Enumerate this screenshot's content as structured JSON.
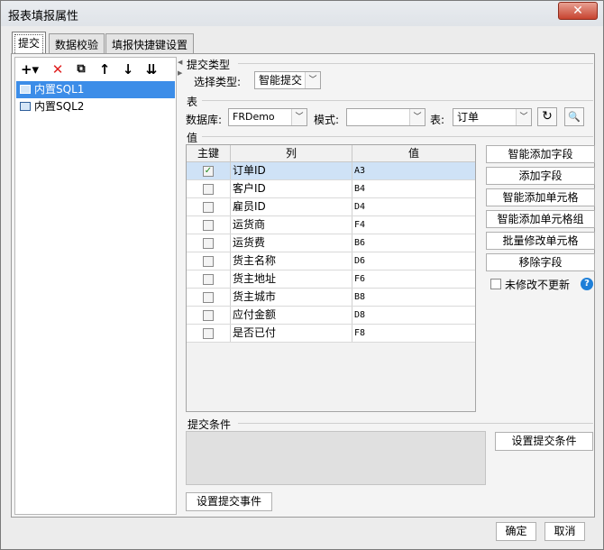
{
  "window": {
    "title": "报表填报属性",
    "close_glyph": "✕"
  },
  "tabs": [
    {
      "label": "提交",
      "active": true
    },
    {
      "label": "数据校验",
      "active": false
    },
    {
      "label": "填报快捷键设置",
      "active": false
    }
  ],
  "left_toolbar": {
    "icons": [
      "add-icon",
      "delete-icon",
      "copy-icon",
      "move-up-icon",
      "move-down-icon",
      "move-bottom-icon"
    ],
    "glyphs": [
      "+▾",
      "✕",
      "⧉",
      "↑",
      "↓",
      "⇊"
    ]
  },
  "left_list": [
    {
      "label": "内置SQL1",
      "selected": true
    },
    {
      "label": "内置SQL2",
      "selected": false
    }
  ],
  "submit_type": {
    "section": "提交类型",
    "label": "选择类型:",
    "value": "智能提交"
  },
  "table_section": {
    "section": "表",
    "db_label": "数据库:",
    "db_value": "FRDemo",
    "mode_label": "模式:",
    "mode_value": "",
    "table_label": "表:",
    "table_value": "订单",
    "refresh_glyph": "↻",
    "preview_glyph": "🔍"
  },
  "value_section": {
    "section": "值",
    "headers": [
      "主键",
      "列",
      "值"
    ],
    "rows": [
      {
        "key": true,
        "column": "订单ID",
        "value": "A3"
      },
      {
        "key": false,
        "column": "客户ID",
        "value": "B4"
      },
      {
        "key": false,
        "column": "雇员ID",
        "value": "D4"
      },
      {
        "key": false,
        "column": "运货商",
        "value": "F4"
      },
      {
        "key": false,
        "column": "运货费",
        "value": "B6"
      },
      {
        "key": false,
        "column": "货主名称",
        "value": "D6"
      },
      {
        "key": false,
        "column": "货主地址",
        "value": "F6"
      },
      {
        "key": false,
        "column": "货主城市",
        "value": "B8"
      },
      {
        "key": false,
        "column": "应付金额",
        "value": "D8"
      },
      {
        "key": false,
        "column": "是否已付",
        "value": "F8"
      }
    ],
    "check_glyph": "✓"
  },
  "side_buttons": [
    "智能添加字段",
    "添加字段",
    "智能添加单元格",
    "智能添加单元格组",
    "批量修改单元格",
    "移除字段"
  ],
  "no_update_unmodified": {
    "label": "未修改不更新",
    "checked": false,
    "help_glyph": "?"
  },
  "submit_condition": {
    "section": "提交条件",
    "button": "设置提交条件"
  },
  "submit_event_button": "设置提交事件",
  "footer": {
    "ok": "确定",
    "cancel": "取消"
  },
  "colors": {
    "selection": "#3c8de8",
    "row_selected": "#cfe2f6",
    "close": "#c7432f"
  }
}
